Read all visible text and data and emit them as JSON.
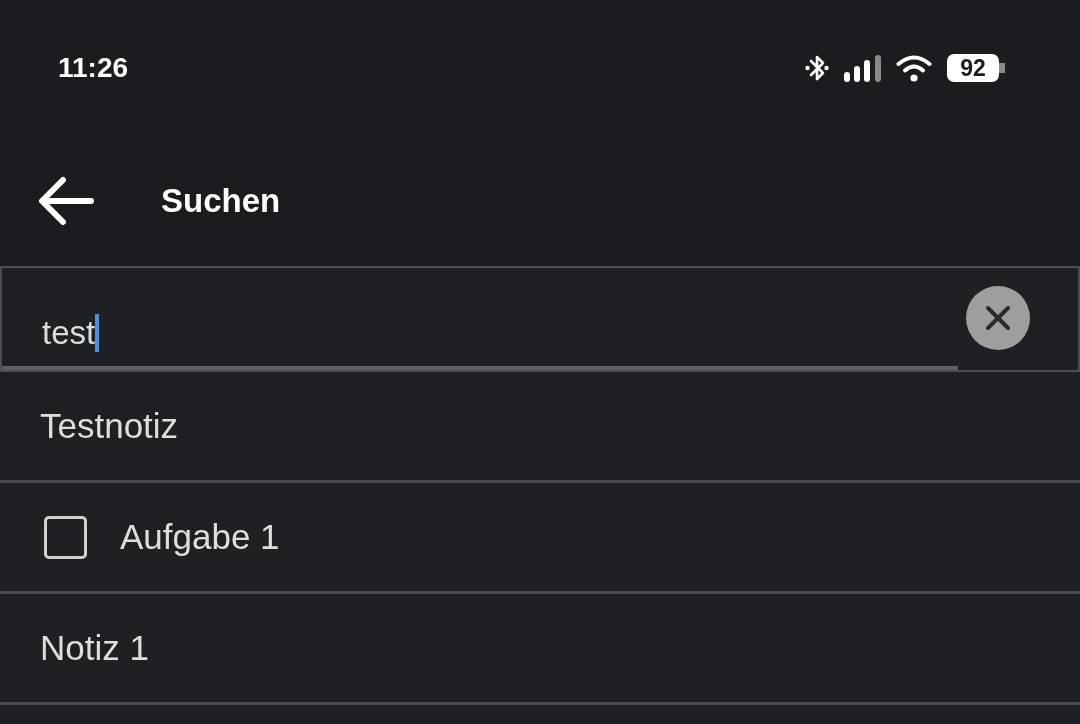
{
  "status_bar": {
    "time": "11:26",
    "battery": "92"
  },
  "header": {
    "title": "Suchen"
  },
  "search": {
    "value": "test"
  },
  "results": [
    {
      "kind": "note",
      "title": "Testnotiz"
    },
    {
      "kind": "task",
      "title": "Aufgabe 1",
      "checked": false
    },
    {
      "kind": "note",
      "title": "Notiz 1"
    }
  ]
}
